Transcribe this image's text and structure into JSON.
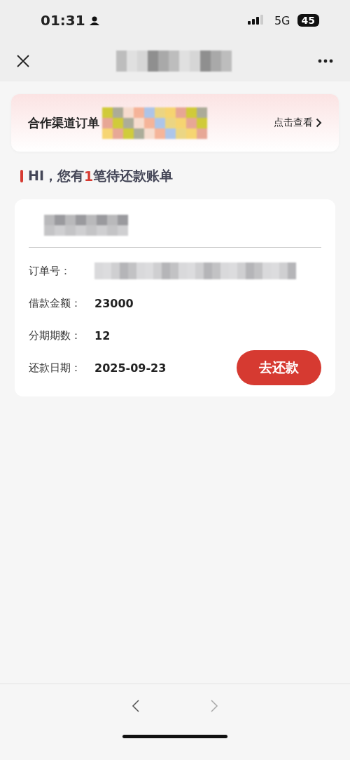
{
  "status_bar": {
    "time": "01:31",
    "network": "5G",
    "battery": "45"
  },
  "banner": {
    "title": "合作渠道订单",
    "link": "点击查看"
  },
  "greeting": {
    "prefix": "HI，您有",
    "count": "1",
    "suffix": "笔待还款账单"
  },
  "bill": {
    "fields": [
      {
        "label": "订单号：",
        "kind": "redacted"
      },
      {
        "label": "借款金额：",
        "value": "23000",
        "kind": "text"
      },
      {
        "label": "分期期数：",
        "value": "12",
        "kind": "text"
      },
      {
        "label": "还款日期：",
        "value": "2025-09-23",
        "kind": "text"
      }
    ],
    "button": "去还款"
  }
}
